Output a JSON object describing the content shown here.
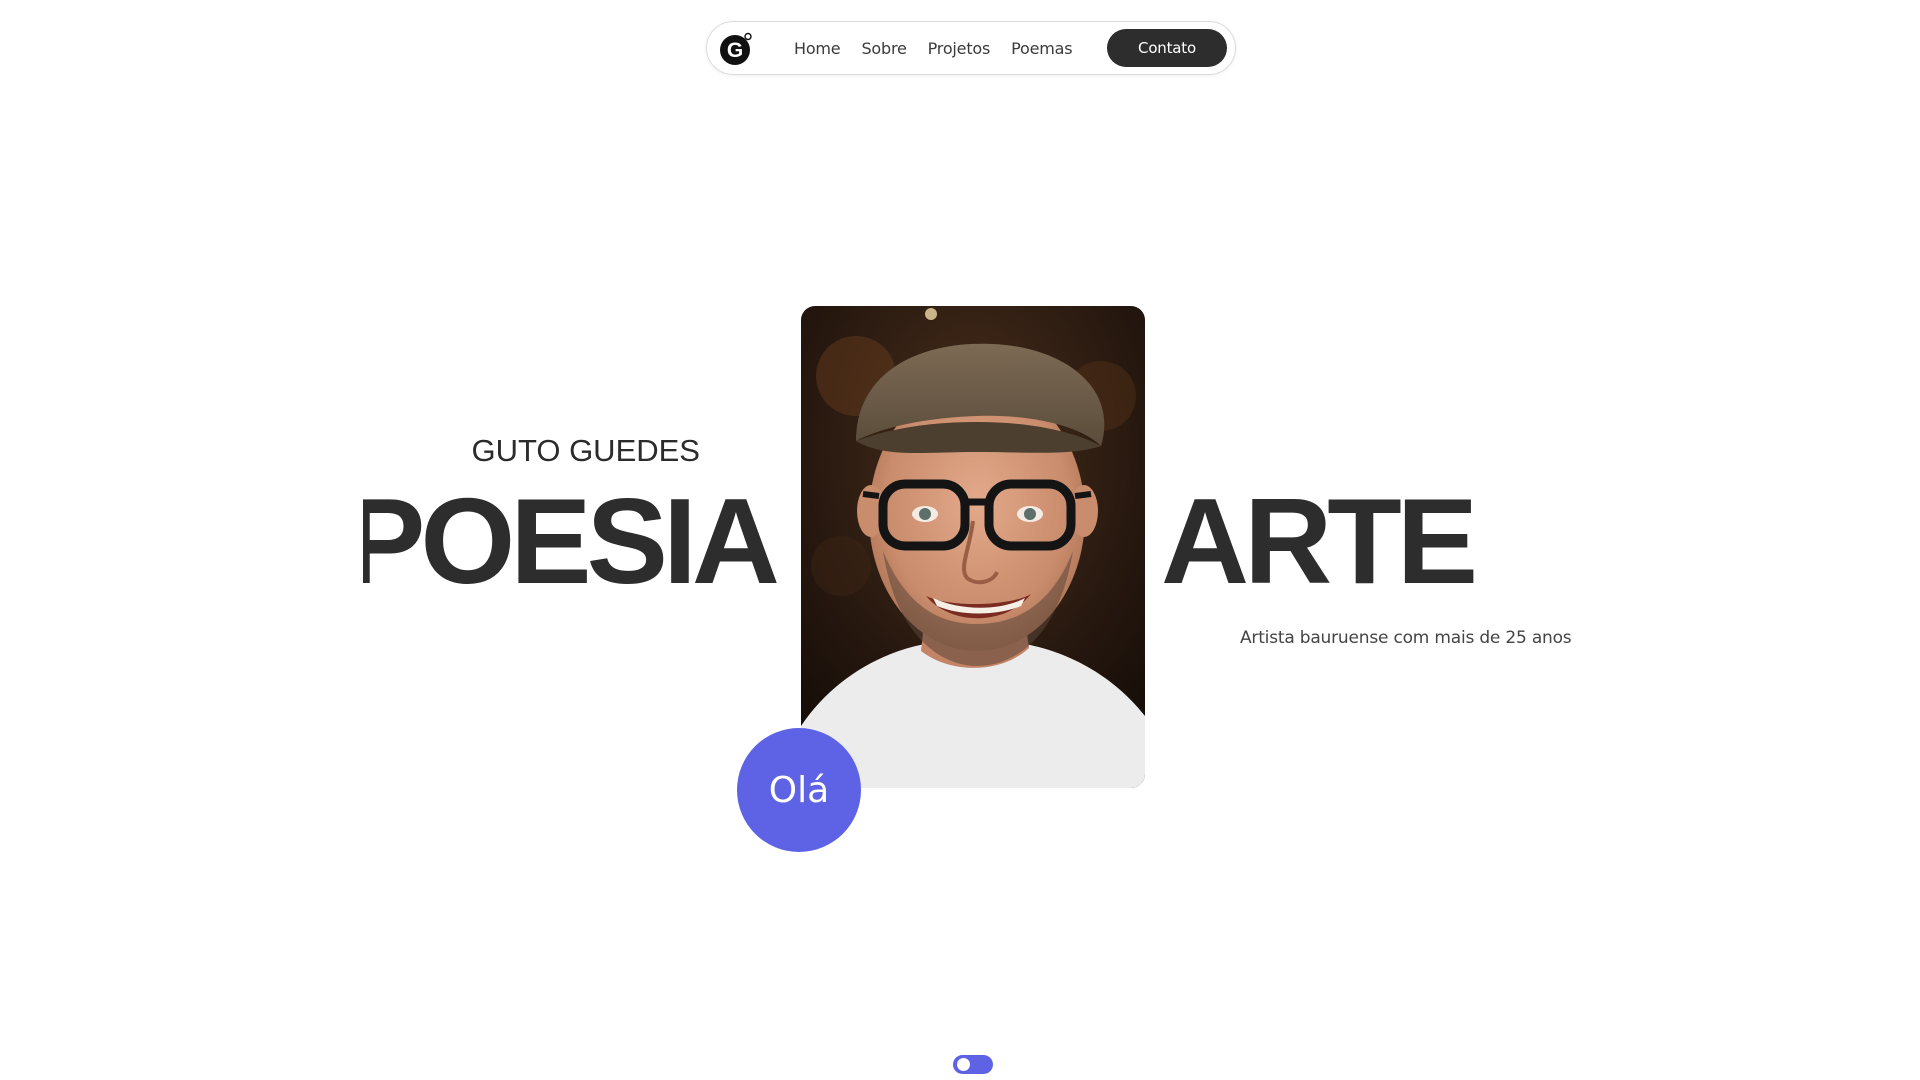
{
  "nav": {
    "logo_letter": "G",
    "links": [
      {
        "label": "Home"
      },
      {
        "label": "Sobre"
      },
      {
        "label": "Projetos"
      },
      {
        "label": "Poemas"
      }
    ],
    "contact_label": "Contato"
  },
  "hero": {
    "subtitle": "GUTO GUEDES",
    "word_left": "POESIA",
    "word_right": "ARTE",
    "tagline": "Artista bauruense com mais de 25 anos",
    "hello": "Olá"
  },
  "icons": {
    "logo": "g-logo-icon",
    "toggle": "theme-toggle"
  },
  "colors": {
    "accent": "#5e63e6",
    "dark": "#2d2d2d",
    "text": "#2b2b2b",
    "background": "#ffffff"
  }
}
